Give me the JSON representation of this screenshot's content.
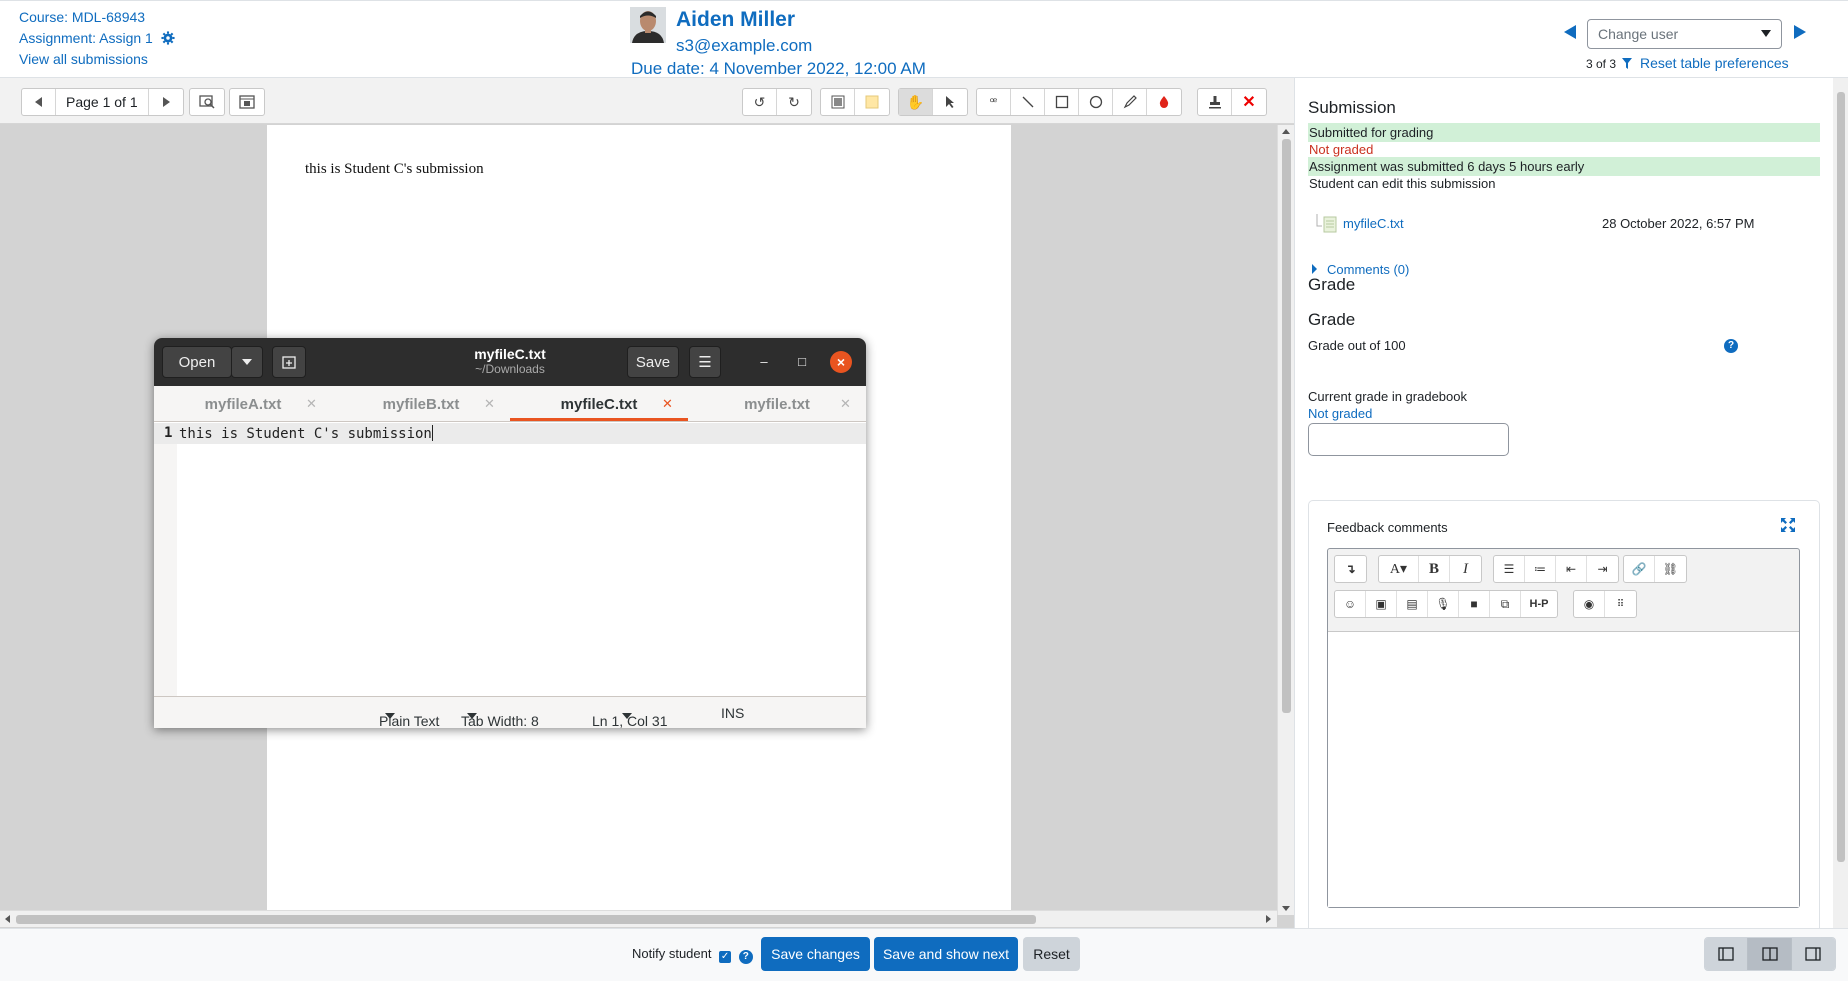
{
  "header": {
    "course": "Course: MDL-68943",
    "assignment": "Assignment: Assign 1",
    "view_all": "View all submissions",
    "user_name": "Aiden Miller",
    "user_email": "s3@example.com",
    "due_date": "Due date: 4 November 2022, 12:00 AM",
    "change_user_placeholder": "Change user",
    "counter": "3 of 3",
    "reset_prefs": "Reset table preferences"
  },
  "doc_toolbar": {
    "page_label": "Page 1 of 1"
  },
  "document": {
    "text": "this is Student C's submission"
  },
  "gedit": {
    "open_label": "Open",
    "file_name": "myfileC.txt",
    "file_path": "~/Downloads",
    "save_label": "Save",
    "tabs": [
      {
        "label": "myfileA.txt",
        "active": false
      },
      {
        "label": "myfileB.txt",
        "active": false
      },
      {
        "label": "myfileC.txt",
        "active": true
      },
      {
        "label": "myfile.txt",
        "active": false
      }
    ],
    "line_number": "1",
    "line_text": "this is Student C's submission",
    "status": {
      "language": "Plain Text",
      "tab_width": "Tab Width: 8",
      "position": "Ln 1, Col 31",
      "mode": "INS"
    }
  },
  "panel": {
    "submission_heading": "Submission",
    "status_submitted": "Submitted for grading",
    "status_not_graded": "Not graded",
    "status_early": "Assignment was submitted 6 days 5 hours early",
    "status_edit": "Student can edit this submission",
    "file_name": "myfileC.txt",
    "file_date": "28 October 2022, 6:57 PM",
    "comments": "Comments (0)",
    "grade_heading_1": "Grade",
    "grade_heading_2": "Grade",
    "grade_out_of": "Grade out of 100",
    "current_grade_label": "Current grade in gradebook",
    "current_grade_value": "Not graded",
    "feedback_title": "Feedback comments"
  },
  "footer": {
    "notify": "Notify student",
    "save_changes": "Save changes",
    "save_next": "Save and show next",
    "reset": "Reset"
  },
  "colors": {
    "brand": "#0f6cbf",
    "success_bg": "#d1f0d7",
    "danger": "#ca3120",
    "ubuntu_orange": "#e95420"
  }
}
